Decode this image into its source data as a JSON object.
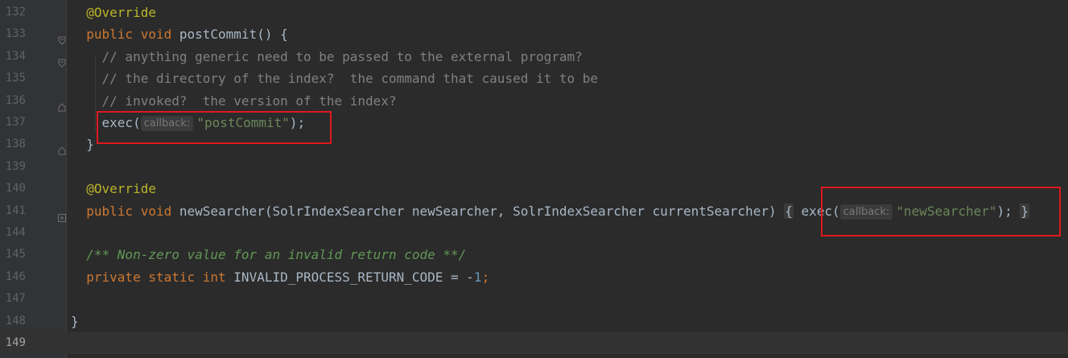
{
  "lines": [
    {
      "no": "132",
      "indent": "  ",
      "tokens": [
        {
          "cls": "ann",
          "text": "@Override"
        }
      ]
    },
    {
      "no": "133",
      "indent": "  ",
      "fold": "open",
      "tokens": [
        {
          "cls": "kw",
          "text": "public void "
        },
        {
          "cls": "",
          "text": "postCommit() {"
        }
      ]
    },
    {
      "no": "134",
      "indent": "    ",
      "fold": "open",
      "tokens": [
        {
          "cls": "cmt",
          "text": "// anything generic need to be passed to the external program?"
        }
      ]
    },
    {
      "no": "135",
      "indent": "    ",
      "tokens": [
        {
          "cls": "cmt",
          "text": "// the directory of the index?  the command that caused it to be"
        }
      ]
    },
    {
      "no": "136",
      "indent": "    ",
      "fold": "close",
      "tokens": [
        {
          "cls": "cmt",
          "text": "// invoked?  the version of the index?"
        }
      ]
    },
    {
      "no": "137",
      "indent": "    ",
      "tokens": [
        {
          "cls": "",
          "text": "exec("
        },
        {
          "cls": "hint",
          "text": "callback:"
        },
        {
          "cls": "str",
          "text": "\"postCommit\""
        },
        {
          "cls": "",
          "text": ");"
        }
      ]
    },
    {
      "no": "138",
      "indent": "  ",
      "fold": "close",
      "tokens": [
        {
          "cls": "",
          "text": "}"
        }
      ]
    },
    {
      "no": "139",
      "indent": "",
      "tokens": []
    },
    {
      "no": "140",
      "indent": "  ",
      "tokens": [
        {
          "cls": "ann",
          "text": "@Override"
        }
      ]
    },
    {
      "no": "141",
      "indent": "  ",
      "fold": "plus",
      "tokens": [
        {
          "cls": "kw",
          "text": "public void "
        },
        {
          "cls": "",
          "text": "newSearcher(SolrIndexSearcher newSearcher, SolrIndexSearcher currentSearcher) "
        },
        {
          "cls": "foldbox",
          "text": "{"
        },
        {
          "cls": "",
          "text": " exec("
        },
        {
          "cls": "hint",
          "text": "callback:"
        },
        {
          "cls": "str",
          "text": "\"newSearcher\""
        },
        {
          "cls": "",
          "text": "); "
        },
        {
          "cls": "foldbox",
          "text": "}"
        }
      ]
    },
    {
      "no": "144",
      "indent": "",
      "tokens": []
    },
    {
      "no": "145",
      "indent": "  ",
      "tokens": [
        {
          "cls": "doc",
          "text": "/** Non-zero value for an invalid return code **/"
        }
      ]
    },
    {
      "no": "146",
      "indent": "  ",
      "tokens": [
        {
          "cls": "kw",
          "text": "private static int "
        },
        {
          "cls": "",
          "text": "INVALID_PROCESS_RETURN_CODE = -"
        },
        {
          "cls": "num",
          "text": "1"
        },
        {
          "cls": "kw",
          "text": ";"
        }
      ]
    },
    {
      "no": "147",
      "indent": "",
      "tokens": []
    },
    {
      "no": "148",
      "indent": "",
      "tokens": [
        {
          "cls": "",
          "text": "}"
        }
      ]
    },
    {
      "no": "149",
      "indent": "",
      "current": true,
      "tokens": []
    }
  ]
}
